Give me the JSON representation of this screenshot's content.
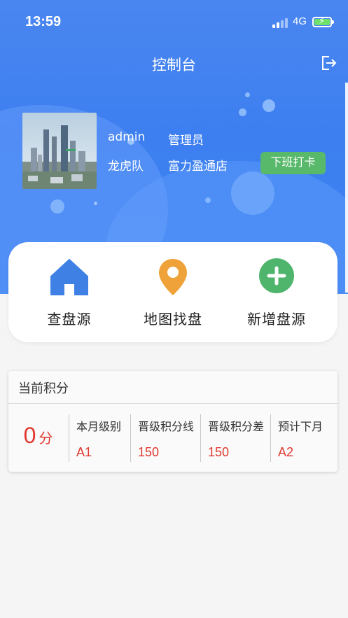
{
  "status_bar": {
    "time": "13:59",
    "network": "4G"
  },
  "header": {
    "title": "控制台"
  },
  "profile": {
    "username": "admin",
    "role": "管理员",
    "team": "龙虎队",
    "store": "富力盈通店",
    "clock_out_label": "下班打卡"
  },
  "quick_actions": [
    {
      "label": "查盘源",
      "icon": "home-icon",
      "color": "#3e80e4"
    },
    {
      "label": "地图找盘",
      "icon": "map-pin-icon",
      "color": "#f0a23a"
    },
    {
      "label": "新增盘源",
      "icon": "plus-circle-icon",
      "color": "#4fb46c"
    }
  ],
  "points": {
    "title": "当前积分",
    "value": "0",
    "unit": "分",
    "columns": [
      {
        "label": "本月级别",
        "value": "A1"
      },
      {
        "label": "晋级积分线",
        "value": "150"
      },
      {
        "label": "晋级积分差",
        "value": "150"
      },
      {
        "label": "预计下月",
        "value": "A2"
      }
    ]
  },
  "colors": {
    "primary": "#3d7ff0",
    "clock_button": "#59b96b",
    "accent_red": "#e0382f"
  }
}
